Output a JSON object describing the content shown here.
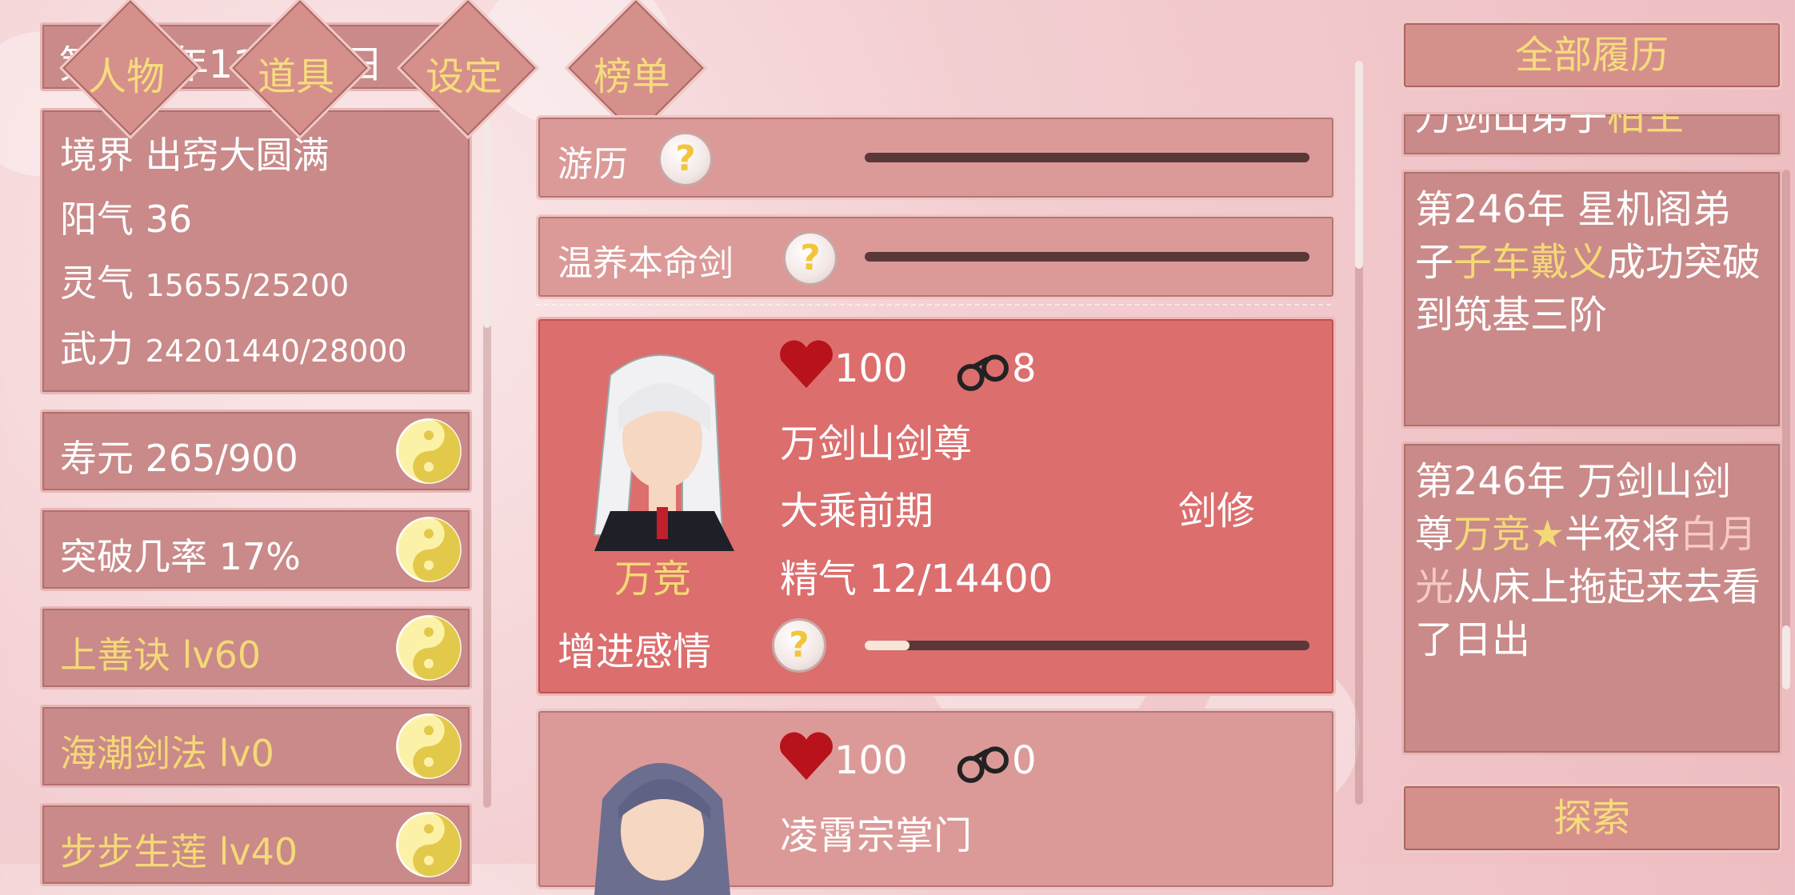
{
  "header": {
    "date_text": "第246年11月24日"
  },
  "nav": {
    "character": "人物",
    "items": "道具",
    "settings": "设定",
    "rankings": "榜单"
  },
  "stats": {
    "realm_label": "境界",
    "realm_value": "出窍大圆满",
    "yang_label": "阳气",
    "yang_value": "36",
    "spirit_label": "灵气",
    "spirit_value": "15655/25200",
    "force_label": "武力",
    "force_value": "24201440/28000"
  },
  "skills": [
    {
      "label": "寿元 265/900",
      "highlight": false
    },
    {
      "label": "突破几率 17%",
      "highlight": false
    },
    {
      "label": "上善诀 lv60",
      "highlight": true
    },
    {
      "label": "海潮剑法 lv0",
      "highlight": true
    },
    {
      "label": "步步生莲 lv40",
      "highlight": true
    }
  ],
  "activities": [
    {
      "label": "游历",
      "progress": 0
    },
    {
      "label": "温养本命剑",
      "progress": 0
    }
  ],
  "characters": [
    {
      "name": "万竞",
      "hp": "100",
      "bond": "8",
      "title": "万剑山剑尊",
      "stage": "大乘前期",
      "class": "剑修",
      "essence": "精气 12/14400",
      "action": "增进感情",
      "action_progress": 0.1
    },
    {
      "hp": "100",
      "bond": "0",
      "title": "凌霄宗掌门"
    }
  ],
  "history": {
    "header": "全部履历",
    "entries": [
      {
        "before": "万剑山弟子",
        "name": "柏生",
        "after": "",
        "partial": true
      },
      {
        "before": "第246年 星机阁弟子",
        "name": "子车戴义",
        "after": "成功突破到筑基三阶"
      },
      {
        "before": "第246年 万剑山剑尊",
        "name": "万竞★",
        "after": "半夜将",
        "name2": "白月光",
        "after2": "从床上拖起来去看了日出"
      }
    ],
    "explore_label": "探索"
  },
  "colors": {
    "panel": "#c98a89",
    "card": "#dc6e6e",
    "gold": "#f5d877",
    "pink": "#f6c9c4"
  }
}
